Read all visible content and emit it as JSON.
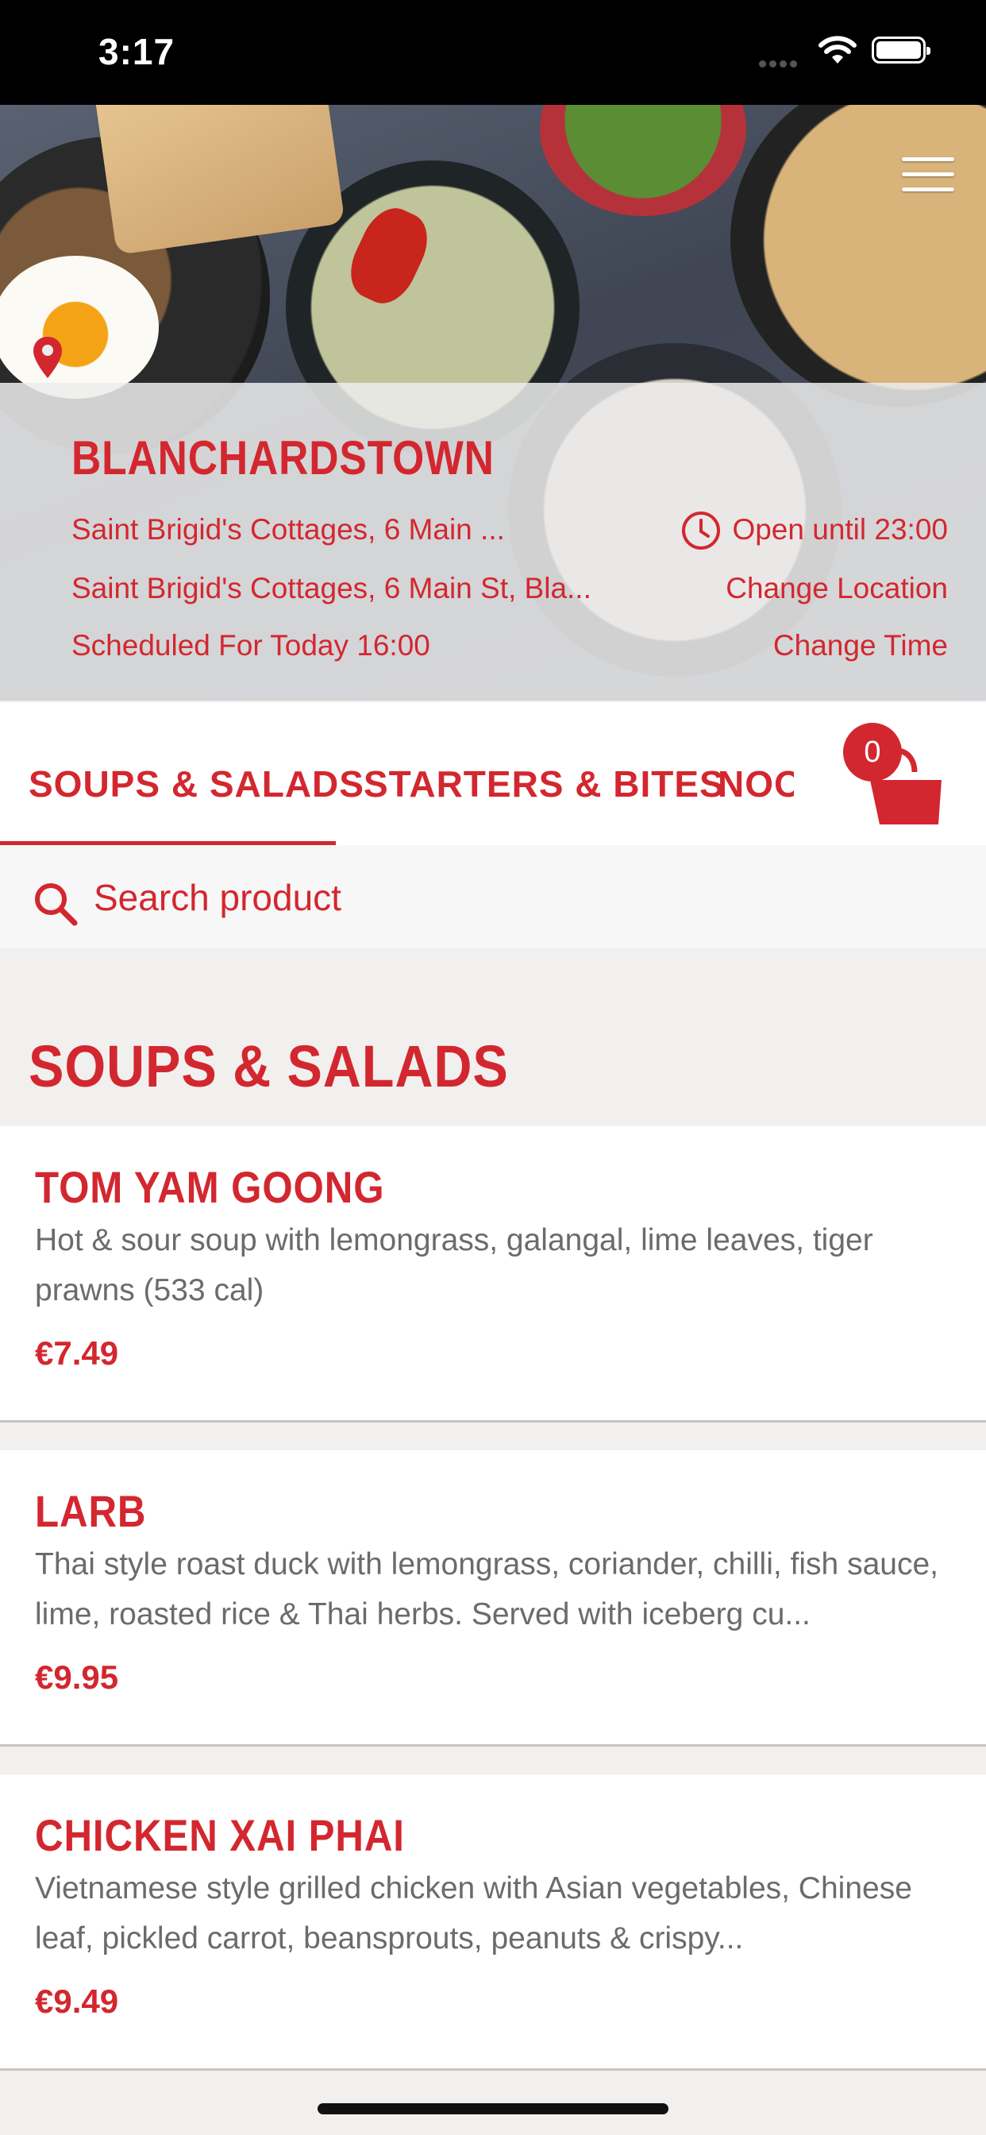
{
  "status_bar": {
    "time": "3:17"
  },
  "store": {
    "name": "BLANCHARDSTOWN",
    "address_short": "Saint Brigid's Cottages, 6 Main ...",
    "address_full": "Saint Brigid's Cottages, 6 Main St, Bla...",
    "hours": "Open until 23:00",
    "change_location": "Change Location",
    "scheduled": "Scheduled For Today 16:00",
    "change_time": "Change Time"
  },
  "tabs": [
    {
      "label": "SOUPS & SALADS",
      "active": true
    },
    {
      "label": "STARTERS & BITES",
      "active": false
    },
    {
      "label": "NOODLES",
      "active": false
    }
  ],
  "cart": {
    "count": "0"
  },
  "search": {
    "placeholder": "Search product"
  },
  "section": {
    "title": "SOUPS & SALADS"
  },
  "products": [
    {
      "name": "TOM YAM GOONG",
      "description": "Hot & sour soup with lemongrass, galangal, lime leaves, tiger prawns (533 cal)",
      "price": "€7.49"
    },
    {
      "name": "LARB",
      "description": "Thai style roast duck with lemongrass, coriander, chilli, fish sauce, lime, roasted rice & Thai herbs. Served with iceberg cu...",
      "price": "€9.95"
    },
    {
      "name": "CHICKEN XAI PHAI",
      "description": "Vietnamese style grilled chicken with Asian vegetables, Chinese leaf, pickled carrot, beansprouts, peanuts & crispy...",
      "price": "€9.49"
    }
  ],
  "colors": {
    "accent": "#d3272f",
    "text_muted": "#6b6b6b",
    "background": "#f2f0ee"
  }
}
